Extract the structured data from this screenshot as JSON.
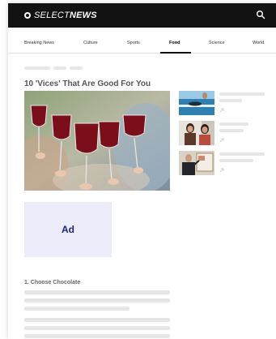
{
  "header": {
    "logo_part1": "SELECT",
    "logo_part2": "NEWS",
    "search_icon": "search-icon"
  },
  "nav": {
    "items": [
      {
        "label": "Breaking News"
      },
      {
        "label": "Culture"
      },
      {
        "label": "Sports"
      },
      {
        "label": "Food"
      },
      {
        "label": "Science"
      },
      {
        "label": "World"
      }
    ],
    "active": "Food"
  },
  "article": {
    "title": "10 'Vices' That Are Good For You",
    "hero_image": "wine-glasses-toast-photo",
    "section_heading": "1. Choose Chocolate"
  },
  "related": [
    {
      "image": "swimmer-pool-photo"
    },
    {
      "image": "two-women-photo"
    },
    {
      "image": "presenter-board-photo"
    }
  ],
  "ad": {
    "label": "Ad"
  },
  "colors": {
    "header_bg": "#121212",
    "ad_bg": "#ececfb",
    "ad_text": "#1a237e",
    "skeleton": "#e6e6e6"
  }
}
